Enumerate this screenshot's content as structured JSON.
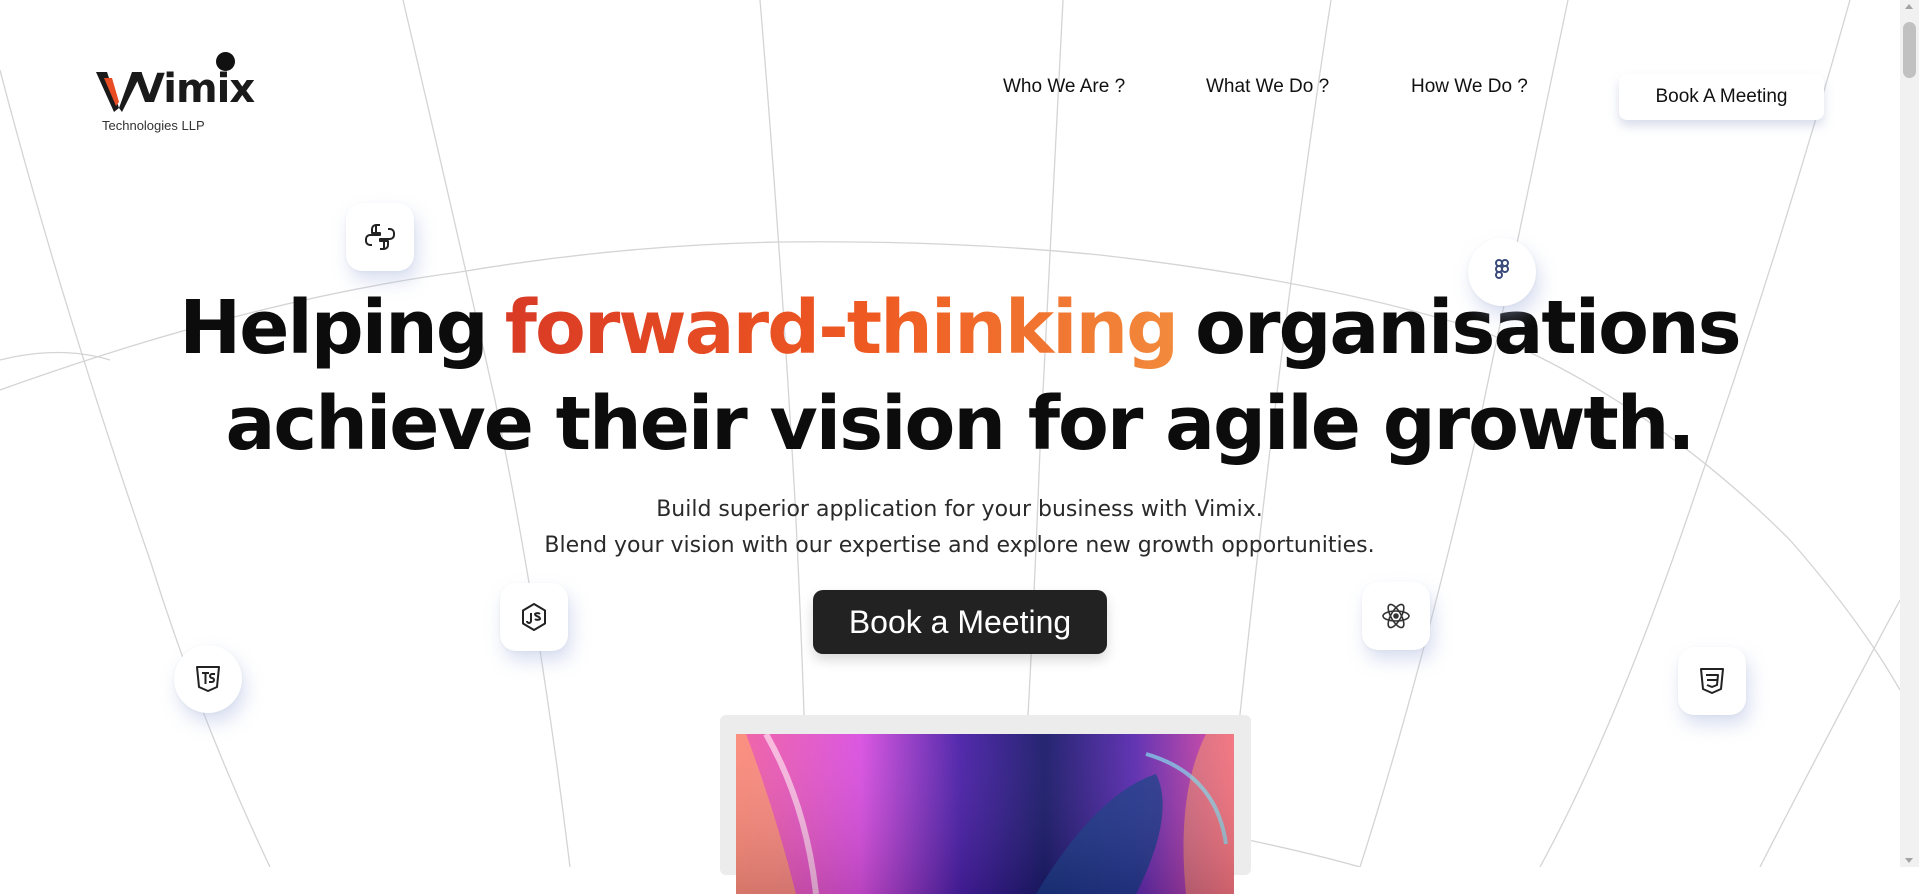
{
  "brand": {
    "name": "Vimix",
    "subtitle": "Technologies LLP",
    "colors": {
      "mark_orange": "#e84c22",
      "mark_dark": "#1a1a1a"
    }
  },
  "nav": {
    "links": [
      "Who We Are ?",
      "What We Do ?",
      "How We Do ?"
    ],
    "cta_label": "Book A Meeting"
  },
  "hero": {
    "headline_part1": "Helping",
    "headline_accent": "forward-thinking",
    "headline_part2": "organisations",
    "headline_line2": "achieve their vision for agile growth.",
    "sub_line1": "Build superior application for your business with Vimix.",
    "sub_line2": "Blend your vision with our expertise and explore new growth opportunities.",
    "cta_label": "Book a Meeting",
    "accent_colors": [
      "#d93a25",
      "#ef5a22",
      "#f28a3c"
    ]
  },
  "tech_icons": [
    "python-icon",
    "figma-icon",
    "nodejs-icon",
    "react-icon",
    "typescript-icon",
    "css3-icon"
  ]
}
